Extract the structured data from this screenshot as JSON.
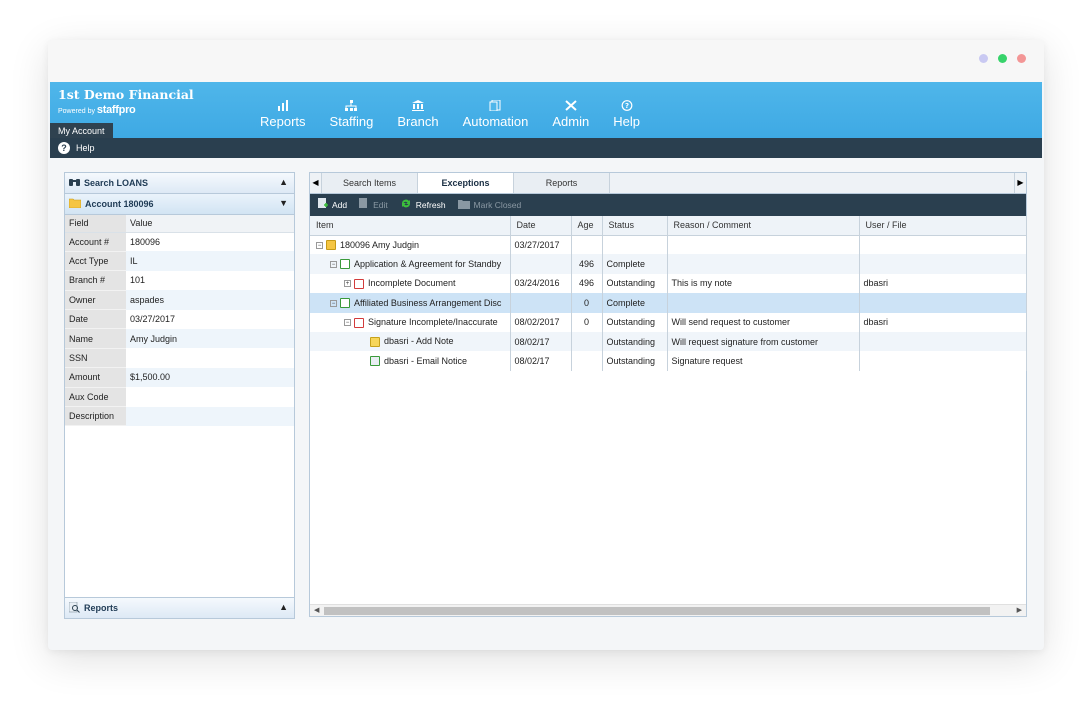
{
  "window": {
    "dots": [
      "#c9c9f2",
      "#37d36b",
      "#f39696"
    ]
  },
  "header": {
    "title": "1st Demo Financial",
    "powered_by": "Powered by",
    "powered_brand": "staffpro",
    "my_account": "My Account",
    "nav": [
      {
        "label": "Reports",
        "icon": "bar-chart-icon"
      },
      {
        "label": "Staffing",
        "icon": "org-chart-icon"
      },
      {
        "label": "Branch",
        "icon": "bank-icon"
      },
      {
        "label": "Automation",
        "icon": "documents-icon"
      },
      {
        "label": "Admin",
        "icon": "tools-icon"
      },
      {
        "label": "Help",
        "icon": "help-icon"
      }
    ]
  },
  "helpbar": {
    "label": "Help"
  },
  "left": {
    "search_title": "Search LOANS",
    "account_title": "Account 180096",
    "col_field": "Field",
    "col_value": "Value",
    "rows": [
      {
        "field": "Account #",
        "value": "180096"
      },
      {
        "field": "Acct Type",
        "value": "IL"
      },
      {
        "field": "Branch #",
        "value": "101"
      },
      {
        "field": "Owner",
        "value": "aspades"
      },
      {
        "field": "Date",
        "value": "03/27/2017"
      },
      {
        "field": "Name",
        "value": "Amy Judgin"
      },
      {
        "field": "SSN",
        "value": ""
      },
      {
        "field": "Amount",
        "value": "$1,500.00"
      },
      {
        "field": "Aux Code",
        "value": ""
      },
      {
        "field": "Description",
        "value": ""
      }
    ],
    "reports_title": "Reports"
  },
  "right": {
    "tabs": [
      "Search Items",
      "Exceptions",
      "Reports"
    ],
    "active_tab": 1,
    "toolbar": {
      "add": "Add",
      "edit": "Edit",
      "refresh": "Refresh",
      "mark_closed": "Mark Closed"
    },
    "columns": [
      "Item",
      "Date",
      "Age",
      "Status",
      "Reason / Comment",
      "User / File"
    ],
    "rows": [
      {
        "item": "180096 Amy Judgin",
        "date": "03/27/2017",
        "age": "",
        "status": "",
        "reason": "",
        "user": ""
      },
      {
        "item": "Application & Agreement for Standby",
        "date": "",
        "age": "496",
        "status": "Complete",
        "reason": "",
        "user": ""
      },
      {
        "item": "Incomplete Document",
        "date": "03/24/2016",
        "age": "496",
        "status": "Outstanding",
        "reason": "This is my note",
        "user": "dbasri"
      },
      {
        "item": "Affiliated Business Arrangement Disc",
        "date": "",
        "age": "0",
        "status": "Complete",
        "reason": "",
        "user": ""
      },
      {
        "item": "Signature Incomplete/Inaccurate",
        "date": "08/02/2017",
        "age": "0",
        "status": "Outstanding",
        "reason": "Will send request to customer",
        "user": "dbasri"
      },
      {
        "item": "dbasri - Add Note",
        "date": "08/02/17",
        "age": "",
        "status": "Outstanding",
        "reason": "Will request signature from customer",
        "user": ""
      },
      {
        "item": "dbasri - Email Notice",
        "date": "08/02/17",
        "age": "",
        "status": "Outstanding",
        "reason": "Signature request",
        "user": ""
      }
    ]
  }
}
